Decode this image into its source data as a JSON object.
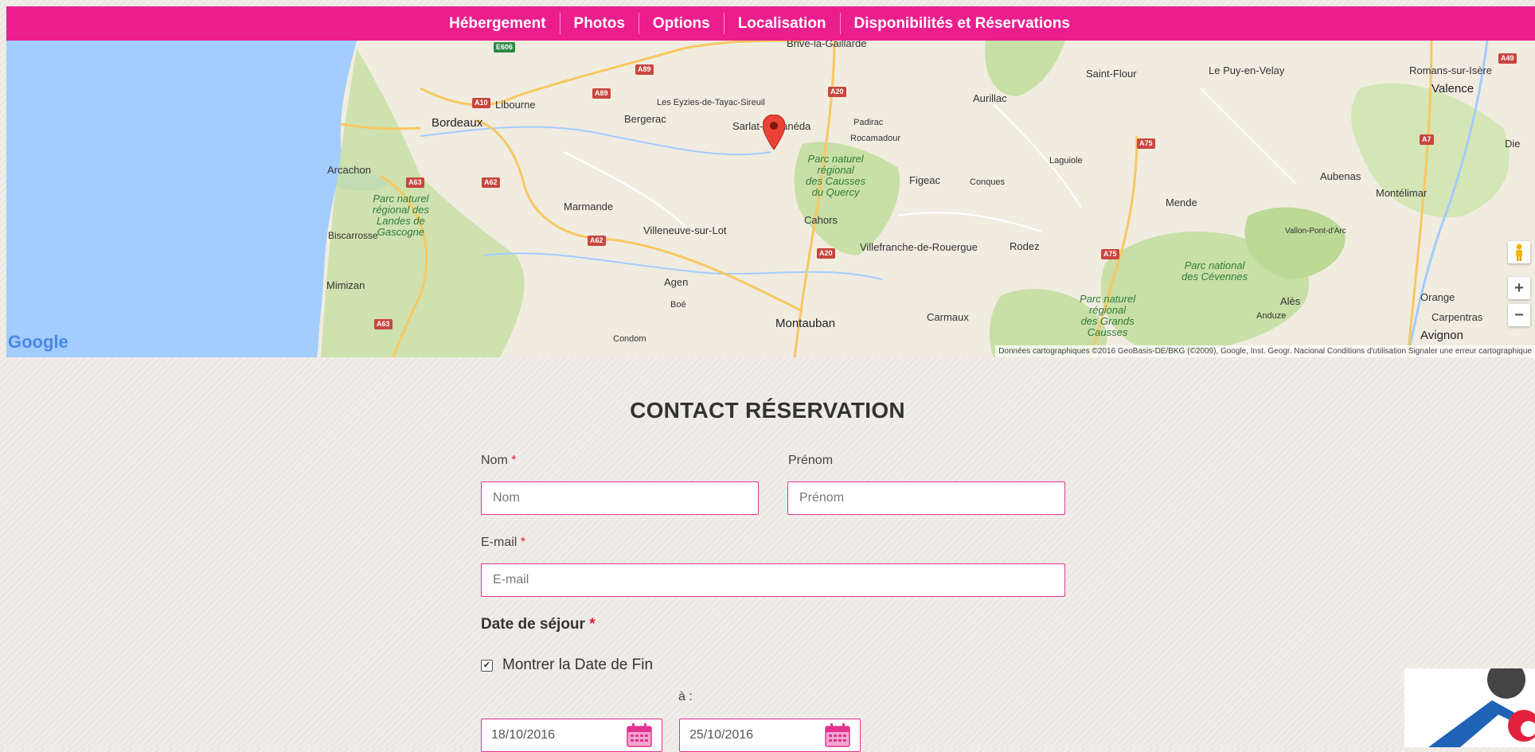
{
  "nav": {
    "items": [
      "Hébergement",
      "Photos",
      "Options",
      "Localisation",
      "Disponibilités et Réservations"
    ]
  },
  "map": {
    "places": {
      "brive": "Brive-la-Gaillarde",
      "libourne": "Libourne",
      "bordeaux": "Bordeaux",
      "bergerac": "Bergerac",
      "eyzies": "Les Eyzies-de-Tayac-Sireuil",
      "sarlat": "Sarlat-la-Canéda",
      "padirac": "Padirac",
      "rocamadour": "Rocamadour",
      "aurillac": "Aurillac",
      "saintflour": "Saint-Flour",
      "lepuy": "Le Puy-en-Velay",
      "romans": "Romans-sur-Isère",
      "valence": "Valence",
      "die": "Die",
      "arcachon": "Arcachon",
      "laguiole": "Laguiole",
      "figeac": "Figeac",
      "conques": "Conques",
      "aubenas": "Aubenas",
      "montelimar": "Montélimar",
      "marmande": "Marmande",
      "mende": "Mende",
      "cahors": "Cahors",
      "villeneuve": "Villeneuve-sur-Lot",
      "biscarrosse": "Biscarrosse",
      "vallon": "Vallon-Pont-d'Arc",
      "villefranche": "Villefranche-de-Rouergue",
      "rodez": "Rodez",
      "mimizan": "Mimizan",
      "agen": "Agen",
      "boe": "Boé",
      "ales": "Alès",
      "orange": "Orange",
      "anduze": "Anduze",
      "carpentras": "Carpentras",
      "montauban": "Montauban",
      "carmaux": "Carmaux",
      "condom": "Condom",
      "avignon": "Avignon"
    },
    "parks": {
      "quercy": "Parc naturel\nrégional\ndes Causses\ndu Quercy",
      "landes": "Parc naturel\nrégional des\nLandes de\nGascogne",
      "cevennes": "Parc national\ndes Cévennes",
      "grandscausses": "Parc naturel\nrégional\ndes Grands\nCausses"
    },
    "highways": {
      "e606": "E606",
      "a89a": "A89",
      "a89b": "A89",
      "a10": "A10",
      "a20a": "A20",
      "a20b": "A20",
      "a49": "A49",
      "a7": "A7",
      "a75a": "A75",
      "a75b": "A75",
      "a63a": "A63",
      "a63b": "A63",
      "a62a": "A62",
      "a62b": "A62"
    },
    "google_logo": "Google",
    "attribution": "Données cartographiques ©2016 GeoBasis-DE/BKG (©2009), Google, Inst. Geogr. Nacional   Conditions d'utilisation   Signaler une erreur cartographique",
    "zoom_in": "+",
    "zoom_out": "−"
  },
  "form": {
    "title": "CONTACT RÉSERVATION",
    "required_mark": "*",
    "nom_label": "Nom",
    "nom_placeholder": "Nom",
    "prenom_label": "Prénom",
    "prenom_placeholder": "Prénom",
    "email_label": "E-mail",
    "email_placeholder": "E-mail",
    "date_label": "Date de séjour",
    "show_end_date_label": "Montrer la Date de Fin",
    "show_end_date_checked": true,
    "to_label": "à :",
    "start_date": "18/10/2016",
    "end_date": "25/10/2016"
  },
  "colors": {
    "accent": "#ec1e8e",
    "field_border": "#e2338f",
    "required": "#e21b3b",
    "map_water": "#a3ccff",
    "map_park": "#c8dfa6"
  }
}
